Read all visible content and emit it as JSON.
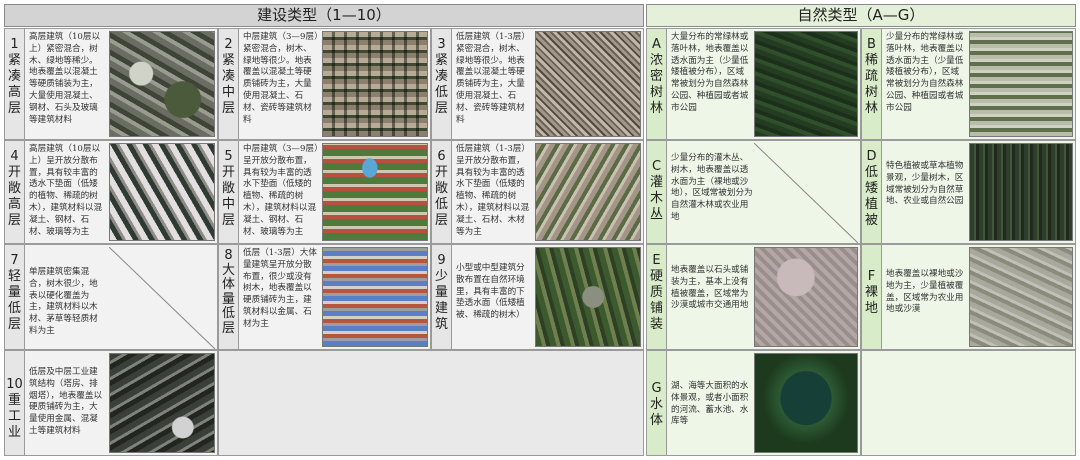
{
  "header": {
    "left": "建设类型（1—10）",
    "right": "自然类型（A—G）"
  },
  "built": [
    {
      "code": [
        "1",
        "紧",
        "凑",
        "高",
        "层"
      ],
      "desc": "高层建筑（10层以上）紧密混合，树木、绿地等稀少。地表覆盖以混凝土等硬质铺装为主，大量使用混凝土、钢材、石头及玻璃等建筑材料"
    },
    {
      "code": [
        "2",
        "紧",
        "凑",
        "中",
        "层"
      ],
      "desc": "中层建筑（3—9层）紧密混合，树木、绿地等很少。地表覆盖以混凝土等硬质铺砖为主，大量使用混凝土、石材、瓷砖等建筑材料"
    },
    {
      "code": [
        "3",
        "紧",
        "凑",
        "低",
        "层"
      ],
      "desc": "低层建筑（1-3层）紧密混合，树木、绿地等很少。地表覆盖以混凝土等硬质铺砖为主，大量使用混凝土、石材、瓷砖等建筑材料"
    },
    {
      "code": [
        "4",
        "开",
        "敞",
        "高",
        "层"
      ],
      "desc": "高层建筑（10层以上）呈开放分散布置，具有较丰富的透水下垫面（低矮的植物、稀疏的树木），建筑材料以混凝土、钢材、石材、玻璃等为主"
    },
    {
      "code": [
        "5",
        "开",
        "敞",
        "中",
        "层"
      ],
      "desc": "中层建筑（3—9层）呈开放分散布置，具有较为丰富的透水下垫面（低矮的植物、稀疏的树木），建筑材料以混凝土、钢材、石材、玻璃等为主"
    },
    {
      "code": [
        "6",
        "开",
        "敞",
        "低",
        "层"
      ],
      "desc": "低层建筑（1-3层）呈开放分散布置，具有较为丰富的透水下垫面（低矮的植物、稀疏的树木），建筑材料以混凝土、石材、木材等为主"
    },
    {
      "code": [
        "7",
        "轻",
        "量",
        "低",
        "层"
      ],
      "desc": "单层建筑密集混合，树木很少，地表以硬化覆盖为主，建筑材料以木材、茅草等轻质材料为主"
    },
    {
      "code": [
        "8",
        "大",
        "体",
        "量",
        "低",
        "层"
      ],
      "desc": "低层（1-3层）大体量建筑呈开放分散布置，很少或没有树木，地表覆盖以硬质铺砖为主，建筑材料以金属、石材为主"
    },
    {
      "code": [
        "9",
        "少",
        "量",
        "建",
        "筑"
      ],
      "desc": "小型或中型建筑分散布置在自然环境里，具有丰富的下垫透水面（低矮植被、稀疏的树木）"
    },
    {
      "code": [
        "10",
        "重",
        "工",
        "业"
      ],
      "desc": "低层及中层工业建筑结构（塔房、排烟塔），地表覆盖以硬质铺砖为主，大量使用金属、混凝土等建筑材料"
    }
  ],
  "natural": [
    {
      "code": [
        "A",
        "浓",
        "密",
        "树",
        "林"
      ],
      "desc": "大量分布的常绿林或落叶林，地表覆盖以透水面为主（少量低矮植被分布），区域常被划分为自然森林公园、种植园或者城市公园"
    },
    {
      "code": [
        "B",
        "稀",
        "疏",
        "树",
        "林"
      ],
      "desc": "少量分布的常绿林或落叶林，地表覆盖以透水面为主（少量低矮植被分布），区域常被划分为自然森林公园、种植园或者城市公园"
    },
    {
      "code": [
        "C",
        "灌",
        "木",
        "丛"
      ],
      "desc": "少量分布的灌木丛、树木，地表覆盖以透水面为主（裸地或沙地），区域常被划分为自然灌木林或农业用地"
    },
    {
      "code": [
        "D",
        "低",
        "矮",
        "植",
        "被"
      ],
      "desc": "特色植被或草本植物景观，少量树木，区域常被划分为自然草地、农业或自然公园"
    },
    {
      "code": [
        "E",
        "硬",
        "质",
        "铺",
        "装"
      ],
      "desc": "地表覆盖以石头或铺装为主，基本上没有植被覆盖，区域常为沙漠或城市交通用地"
    },
    {
      "code": [
        "F",
        "裸",
        "地"
      ],
      "desc": "地表覆盖以裸地或沙地为主，少量植被覆盖，区域常为农业用地或沙漠"
    },
    {
      "code": [
        "G",
        "水",
        "体"
      ],
      "desc": "湖、海等大面积的水体景观，或者小面积的河流、蓄水池、水库等"
    }
  ]
}
